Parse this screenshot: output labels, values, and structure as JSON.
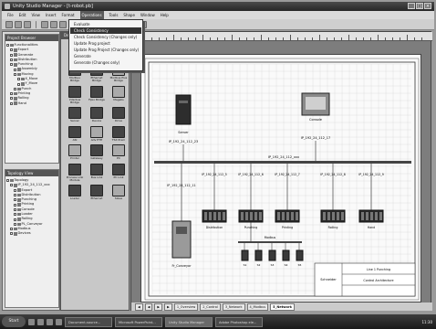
{
  "window": {
    "title": "Unity Studio Manager - [t-robot.pb]"
  },
  "menubar": {
    "items": [
      "File",
      "Edit",
      "View",
      "Insert",
      "Format",
      "Operations",
      "Tools",
      "Shape",
      "Window",
      "Help"
    ],
    "active_index": 5
  },
  "operations_menu": {
    "items": [
      {
        "label": "Evaluate",
        "state": "normal"
      },
      {
        "label": "Check Consistency",
        "state": "highlight"
      },
      {
        "label": "Check Consistency (Changes only)",
        "state": "normal"
      },
      {
        "label": "Update Prog project",
        "state": "normal"
      },
      {
        "label": "Update Prog Project (Changes only)",
        "state": "normal"
      },
      {
        "label": "Generate",
        "state": "normal"
      },
      {
        "label": "Generate (Changes only)",
        "state": "normal"
      }
    ]
  },
  "project_browser": {
    "title": "Project Browser",
    "nodes": [
      {
        "label": "Functionalities",
        "depth": 0
      },
      {
        "label": "Export",
        "depth": 1
      },
      {
        "label": "Generate",
        "depth": 1
      },
      {
        "label": "Distribution",
        "depth": 1
      },
      {
        "label": "Punching",
        "depth": 1
      },
      {
        "label": "Assembly",
        "depth": 2
      },
      {
        "label": "Moving",
        "depth": 2
      },
      {
        "label": "X_Move",
        "depth": 3
      },
      {
        "label": "Y_Move",
        "depth": 3
      },
      {
        "label": "Punch",
        "depth": 2
      },
      {
        "label": "Printing",
        "depth": 1
      },
      {
        "label": "Rolling",
        "depth": 1
      },
      {
        "label": "Hand",
        "depth": 1
      }
    ]
  },
  "topology_browser": {
    "title": "Topology View",
    "nodes": [
      {
        "label": "Topology",
        "depth": 0
      },
      {
        "label": "IP_192_24_112_xxx",
        "depth": 1
      },
      {
        "label": "Export",
        "depth": 2
      },
      {
        "label": "Distribution",
        "depth": 2
      },
      {
        "label": "Punching",
        "depth": 2
      },
      {
        "label": "Printing",
        "depth": 2
      },
      {
        "label": "Console",
        "depth": 2
      },
      {
        "label": "Loader",
        "depth": 2
      },
      {
        "label": "Rolling",
        "depth": 2
      },
      {
        "label": "PL_Conveyor",
        "depth": 2
      },
      {
        "label": "Modbus",
        "depth": 1
      },
      {
        "label": "Devices",
        "depth": 1
      }
    ]
  },
  "palette": {
    "title": "Devices",
    "items": [
      {
        "label": "Station",
        "dark": true
      },
      {
        "label": "Bus Station",
        "dark": true
      },
      {
        "label": "Ethernet Switch",
        "dark": true
      },
      {
        "label": "Modbus Bridge",
        "dark": true
      },
      {
        "label": "Ethernet Bridge",
        "dark": true
      },
      {
        "label": "Modbus Plus Bridge",
        "dark": false
      },
      {
        "label": "Interbus Bridge",
        "dark": true
      },
      {
        "label": "Fipio Bridge",
        "dark": true
      },
      {
        "label": "Magelis",
        "dark": false
      },
      {
        "label": "Server",
        "dark": true
      },
      {
        "label": "Device",
        "dark": true
      },
      {
        "label": "Drive",
        "dark": true
      },
      {
        "label": "ASI",
        "dark": true
      },
      {
        "label": "Adv ETH",
        "dark": false
      },
      {
        "label": "TSX Prem",
        "dark": true
      },
      {
        "label": "Printer",
        "dark": false
      },
      {
        "label": "Gateway",
        "dark": true
      },
      {
        "label": "PC",
        "dark": false
      },
      {
        "label": "Process Link Module",
        "dark": true
      },
      {
        "label": "Bus Link",
        "dark": true
      },
      {
        "label": "PC Link",
        "dark": true
      },
      {
        "label": "Loader",
        "dark": true
      },
      {
        "label": "Ethernet",
        "dark": true
      },
      {
        "label": "Slave",
        "dark": false
      }
    ]
  },
  "diagram": {
    "server": {
      "label": "Server",
      "ip": "IP_192_24_112_23"
    },
    "console": {
      "label": "Console",
      "ip": "IP_192_24_112_17"
    },
    "ethernet_ip": "IP_192_24_112_xxx",
    "drive": {
      "label": "Fr_Conveyor",
      "ip": "IP_192_24_112_11"
    },
    "stations": [
      {
        "label": "Distribution",
        "ip": "IP_192_24_112_5"
      },
      {
        "label": "Punching",
        "ip": "IP_192_24_112_6"
      },
      {
        "label": "Printing",
        "ip": "IP_192_24_112_7"
      },
      {
        "label": "Rolling",
        "ip": "IP_192_24_112_8"
      },
      {
        "label": "Hand",
        "ip": "IP_192_24_112_9"
      }
    ],
    "fieldbus": {
      "label": "Modbus"
    },
    "slaves": [
      "S1",
      "S2",
      "S3",
      "S4",
      "S5"
    ],
    "titleblock": {
      "company": "Schneider",
      "project": "Line 1 Punching",
      "subtitle": "Control Architecture"
    }
  },
  "sheet_tabs": {
    "items": [
      "1_Overview",
      "2_Control",
      "3_Network",
      "4_Modbus",
      "5_Network"
    ],
    "active_index": 4
  },
  "taskbar": {
    "start_label": "Start",
    "tasks": [
      {
        "label": "Document-source...",
        "active": false
      },
      {
        "label": "Microsoft PowerPoint...",
        "active": false
      },
      {
        "label": "Unity Studio Manager",
        "active": true
      },
      {
        "label": "Adobe Photoshop ele...",
        "active": false
      }
    ],
    "clock": "11:30"
  }
}
